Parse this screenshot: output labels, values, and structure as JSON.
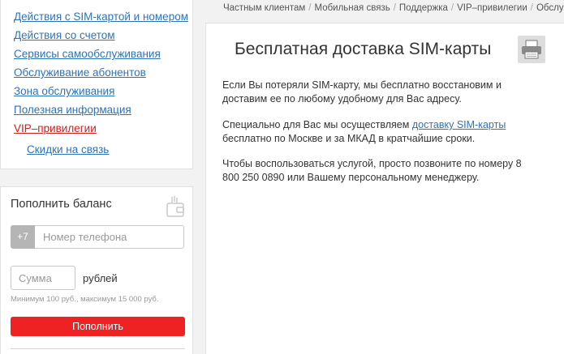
{
  "sidebar": {
    "items": [
      {
        "label": "Действия с SIM-картой и номером"
      },
      {
        "label": "Действия со счетом"
      },
      {
        "label": "Сервисы самообслуживания"
      },
      {
        "label": "Обслуживание абонентов"
      },
      {
        "label": "Зона обслуживания"
      },
      {
        "label": "Полезная информация"
      },
      {
        "label": "VIP–привилегии"
      },
      {
        "label": "Скидки на связь"
      }
    ]
  },
  "topup": {
    "title": "Пополнить баланс",
    "phone_prefix": "+7",
    "phone_placeholder": "Номер телефона",
    "amount_placeholder": "Сумма",
    "currency_label": "рублей",
    "limits_note": "Минимум 100 руб., максимум 15 000 руб.",
    "submit_label": "Пополнить"
  },
  "breadcrumb": [
    "Частным клиентам",
    "Мобильная связь",
    "Поддержка",
    "VIP–привилегии",
    "Обслужива"
  ],
  "main": {
    "title": "Бесплатная доставка SIM-карты",
    "p1": "Если Вы потеряли SIM-карту, мы бесплатно восстановим и доставим ее по любому удобному для Вас адресу.",
    "p2_before": "Специально для Вас мы осуществляем ",
    "p2_link": "доставку SIM-карты",
    "p2_after": " бесплатно по Москве и за МКАД в кратчайшие сроки.",
    "p3": "Чтобы воспользоваться услугой, просто позвоните по номеру 8 800 250 0890 или Вашему персональному менеджеру."
  },
  "colors": {
    "link": "#2e73b8",
    "active": "#d31c1c",
    "button": "#ee2222"
  },
  "icons": [
    "wallet-icon",
    "printer-icon"
  ]
}
